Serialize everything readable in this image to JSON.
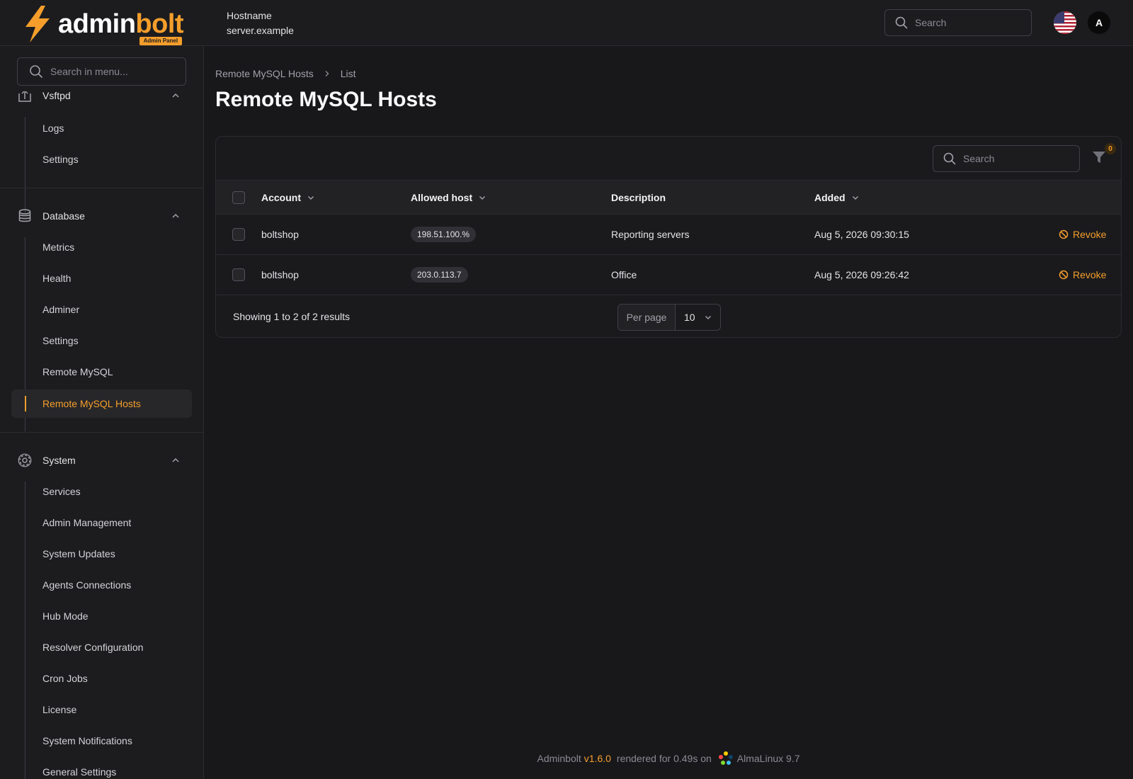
{
  "topbar": {
    "logo_part1": "admin",
    "logo_part2": "bolt",
    "logo_badge": "Admin Panel",
    "hostname_label": "Hostname",
    "hostname_value": "server.example",
    "search_placeholder": "Search",
    "avatar_initial": "A",
    "accent_color": "#f59e2b"
  },
  "sidebar": {
    "search_placeholder": "Search in menu...",
    "groups": [
      {
        "label": "Vsftpd",
        "icon": "upload-icon",
        "expanded": true,
        "items": [
          {
            "label": "Logs"
          },
          {
            "label": "Settings"
          }
        ]
      },
      {
        "label": "Database",
        "icon": "database-icon",
        "expanded": true,
        "items": [
          {
            "label": "Metrics"
          },
          {
            "label": "Health"
          },
          {
            "label": "Adminer"
          },
          {
            "label": "Settings"
          },
          {
            "label": "Remote MySQL"
          },
          {
            "label": "Remote MySQL Hosts",
            "active": true
          }
        ]
      },
      {
        "label": "System",
        "icon": "gear-icon",
        "expanded": true,
        "items": [
          {
            "label": "Services"
          },
          {
            "label": "Admin Management"
          },
          {
            "label": "System Updates"
          },
          {
            "label": "Agents Connections"
          },
          {
            "label": "Hub Mode"
          },
          {
            "label": "Resolver Configuration"
          },
          {
            "label": "Cron Jobs"
          },
          {
            "label": "License"
          },
          {
            "label": "System Notifications"
          },
          {
            "label": "General Settings"
          }
        ]
      }
    ]
  },
  "main": {
    "breadcrumb": [
      "Remote MySQL Hosts",
      "List"
    ],
    "title": "Remote MySQL Hosts",
    "table": {
      "search_placeholder": "Search",
      "filter_count": "0",
      "columns": [
        {
          "label": "Account",
          "sortable": true
        },
        {
          "label": "Allowed host",
          "sortable": true
        },
        {
          "label": "Description",
          "sortable": false
        },
        {
          "label": "Added",
          "sortable": true
        }
      ],
      "rows": [
        {
          "account": "boltshop",
          "host": "198.51.100.%",
          "description": "Reporting servers",
          "added": "Aug 5, 2026 09:30:15",
          "action": "Revoke"
        },
        {
          "account": "boltshop",
          "host": "203.0.113.7",
          "description": "Office",
          "added": "Aug 5, 2026 09:26:42",
          "action": "Revoke"
        }
      ],
      "showing": "Showing 1 to 2 of 2 results",
      "per_page_label": "Per page",
      "per_page_value": "10"
    }
  },
  "footer": {
    "product": "Adminbolt",
    "version": "v1.6.0",
    "rendered": "rendered for 0.49s on",
    "os": "AlmaLinux 9.7"
  }
}
